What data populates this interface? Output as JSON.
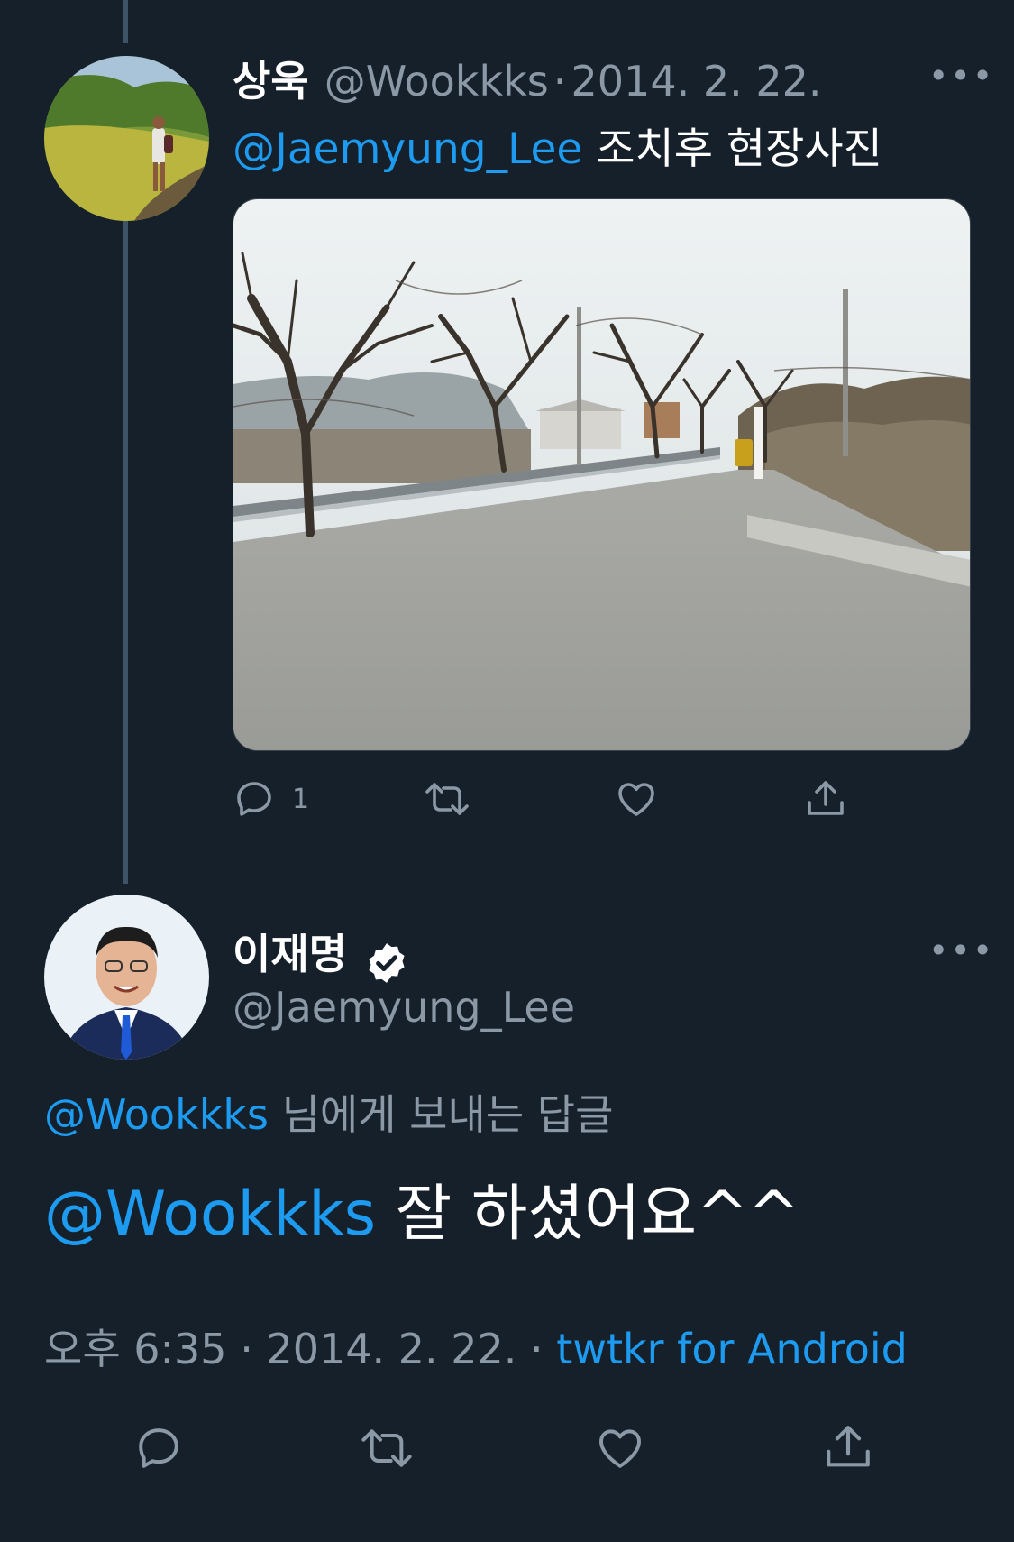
{
  "parent_tweet": {
    "display_name": "상욱",
    "handle": "@Wookkks",
    "separator": "·",
    "date": "2014. 2. 22.",
    "more_label": "•••",
    "mention": "@Jaemyung_Lee",
    "text": " 조치후  현장사진",
    "reply_count": "1"
  },
  "main_tweet": {
    "display_name": "이재명",
    "handle": "@Jaemyung_Lee",
    "more_label": "•••",
    "replying_to_handle": "@Wookkks",
    "replying_to_suffix": " 님에게 보내는 답글",
    "mention": "@Wookkks",
    "text": " 잘 하셨어요^^",
    "time": "오후 6:35",
    "separator": "·",
    "date": "2014. 2. 22.",
    "separator2": "·",
    "source": "twtkr for Android"
  },
  "colors": {
    "background": "#15202b",
    "accent": "#1d9bf0",
    "secondary_text": "#8b98a5",
    "thread_line": "#3d5466"
  },
  "icons": [
    "reply-icon",
    "retweet-icon",
    "like-icon",
    "share-icon",
    "verified-badge-icon",
    "more-icon"
  ]
}
